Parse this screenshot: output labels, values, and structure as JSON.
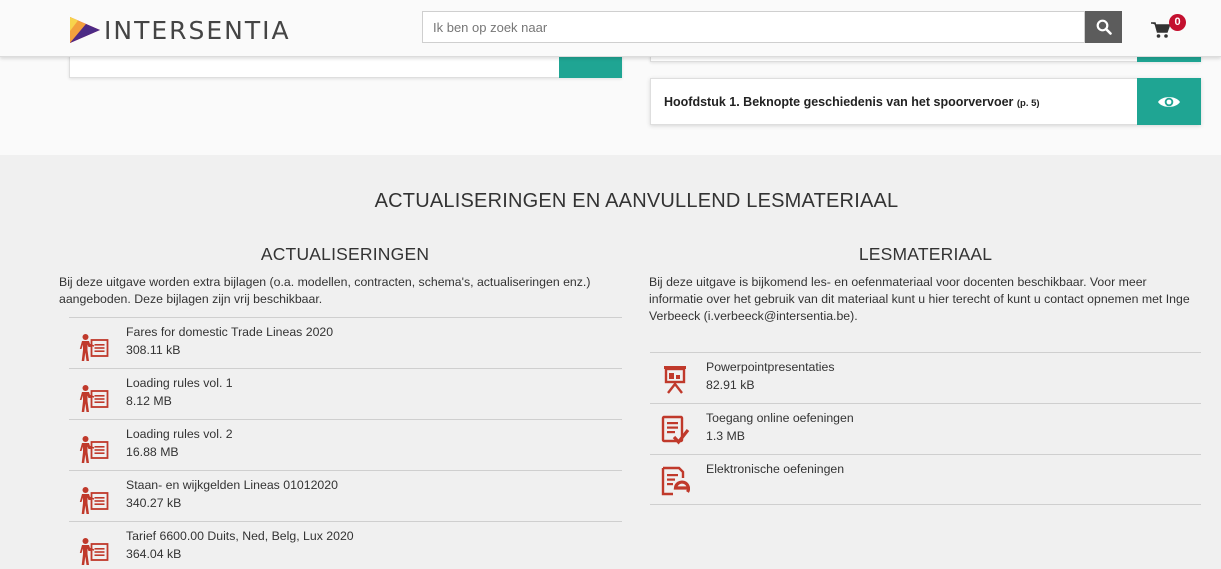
{
  "header": {
    "brand": "INTERSENTIA",
    "search_placeholder": "Ik ben op zoek naar",
    "cart_count": "0"
  },
  "chapter": {
    "title": "Hoofdstuk 1. Beknopte geschiedenis van het spoorvervoer",
    "page": "(p. 5)"
  },
  "section": {
    "title": "ACTUALISERINGEN EN AANVULLEND LESMATERIAAL"
  },
  "actualiseringen": {
    "title": "ACTUALISERINGEN",
    "description": "Bij deze uitgave worden extra bijlagen (o.a. modellen, contracten, schema's, actualiseringen enz.) aangeboden. Deze bijlagen zijn vrij beschikbaar.",
    "items": [
      {
        "name": "Fares for domestic Trade Lineas 2020",
        "size": "308.11 kB",
        "icon": "presenter-icon"
      },
      {
        "name": "Loading rules vol. 1",
        "size": "8.12 MB",
        "icon": "presenter-icon"
      },
      {
        "name": "Loading rules vol. 2",
        "size": "16.88 MB",
        "icon": "presenter-icon"
      },
      {
        "name": "Staan- en wijkgelden Lineas 01012020",
        "size": "340.27 kB",
        "icon": "presenter-icon"
      },
      {
        "name": "Tarief 6600.00 Duits, Ned, Belg, Lux 2020",
        "size": "364.04 kB",
        "icon": "presenter-icon"
      }
    ]
  },
  "lesmateriaal": {
    "title": "LESMATERIAAL",
    "description": "Bij deze uitgave is bijkomend les- en oefenmateriaal voor docenten beschikbaar. Voor meer informatie over het gebruik van dit materiaal kunt u hier terecht of kunt u contact opnemen met Inge Verbeeck (i.verbeeck@intersentia.be).",
    "items": [
      {
        "name": "Powerpointpresentaties",
        "size": "82.91 kB",
        "icon": "projector-icon"
      },
      {
        "name": "Toegang online oefeningen",
        "size": "1.3 MB",
        "icon": "checklist-icon"
      },
      {
        "name": "Elektronische oefeningen",
        "size": "",
        "icon": "e-document-icon"
      }
    ]
  },
  "colors": {
    "accent": "#1fa593",
    "icon": "#c0392b",
    "badge": "#c4102f",
    "section_bg": "#f0f0f0"
  }
}
